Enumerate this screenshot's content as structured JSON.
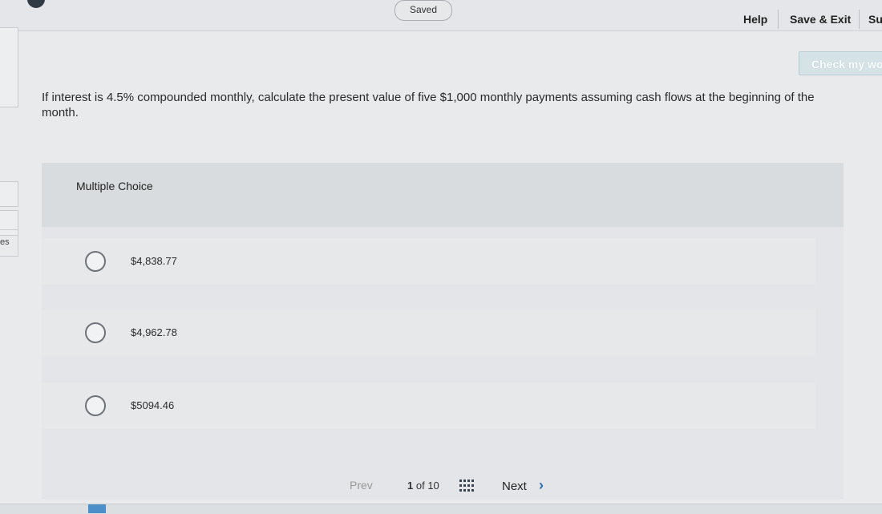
{
  "header": {
    "saved_label": "Saved",
    "help_label": "Help",
    "save_exit_label": "Save & Exit",
    "submit_label": "Su",
    "check_label": "Check my wo"
  },
  "sidebar": {
    "partial_label": "es"
  },
  "question": {
    "text": "If interest is 4.5% compounded monthly, calculate the present value of five $1,000 monthly payments assuming cash flows at the beginning of the month."
  },
  "answer": {
    "title": "Multiple Choice",
    "options": [
      {
        "label": "$4,838.77"
      },
      {
        "label": "$4,962.78"
      },
      {
        "label": "$5094.46"
      }
    ]
  },
  "pagination": {
    "prev_label": "Prev",
    "current": "1",
    "of_label": "of 10",
    "next_label": "Next",
    "next_icon": "chevron-right-icon",
    "grid_icon": "grid-icon"
  },
  "colors": {
    "accent": "#2b6fb0",
    "check_button": "#d5e3e7"
  }
}
